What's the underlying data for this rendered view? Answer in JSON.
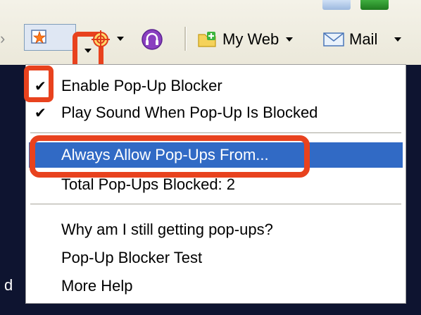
{
  "toolbar": {
    "popup_blocker_icon": "popup-blocker-icon",
    "target_icon": "crosshair-icon",
    "headset_icon": "headset-icon",
    "myweb_icon": "folder-plus-icon",
    "myweb_label": "My Web",
    "mail_icon": "envelope-icon",
    "mail_label": "Mail"
  },
  "menu": {
    "items": [
      {
        "label": "Enable Pop-Up Blocker",
        "checked": true
      },
      {
        "label": "Play Sound When Pop-Up Is Blocked",
        "checked": true
      },
      {
        "label": "Always Allow Pop-Ups From...",
        "highlighted": true
      },
      {
        "label": "Total Pop-Ups Blocked: 2"
      },
      {
        "label": "Why am I still getting pop-ups?"
      },
      {
        "label": "Pop-Up Blocker Test"
      },
      {
        "label": "More Help"
      }
    ]
  },
  "background": {
    "partial_text": "d"
  },
  "colors": {
    "highlight": "#316ac5",
    "callout": "#e8421e",
    "background": "#0e1430"
  }
}
